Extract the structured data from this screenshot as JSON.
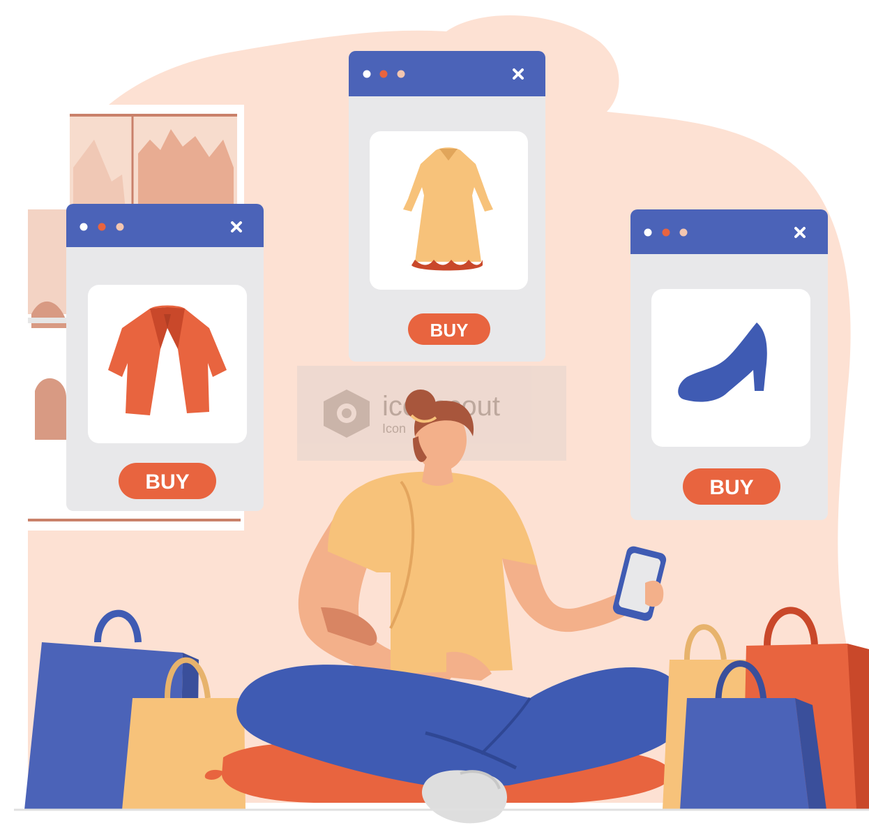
{
  "illustration": {
    "subject": "online-shopping",
    "colors": {
      "blob": "#fde1d3",
      "window_bar": "#4b63b8",
      "window_body": "#e8e8ea",
      "card": "#ffffff",
      "accent_orange": "#e8643f",
      "shirt_yellow": "#f7c27a",
      "pants_blue": "#3f5bb3",
      "skin": "#f3b08a",
      "hair": "#a8563c"
    }
  },
  "windows": [
    {
      "id": "left",
      "product": "jacket",
      "button_label": "BUY"
    },
    {
      "id": "center",
      "product": "dress",
      "button_label": "BUY"
    },
    {
      "id": "right",
      "product": "high-heel",
      "button_label": "BUY"
    }
  ],
  "watermark": {
    "brand": "iconscout",
    "sub": "Icon"
  }
}
